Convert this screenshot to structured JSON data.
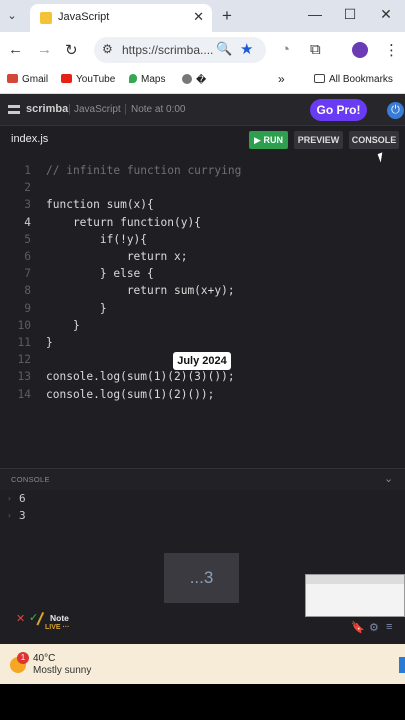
{
  "browser": {
    "tab_title": "JavaScript",
    "url": "https://scrimba....",
    "bookmarks": [
      "Gmail",
      "YouTube",
      "Maps",
      "�"
    ],
    "all_bookmarks": "All Bookmarks",
    "glyphs": {
      "menu": "⌄",
      "close": "✕",
      "new_tab": "+",
      "minimize": "—",
      "maximize": "☐",
      "back": "←",
      "forward": "→",
      "reload": "↻",
      "tune": "⚙",
      "zoom": "🔍",
      "star": "★",
      "ext1": "◔",
      "ext2": "⧉",
      "overflow": "»",
      "folder": "▭",
      "kebab": "⋮"
    }
  },
  "scrimba": {
    "logo": "scrimba",
    "crumb_course": "JavaScript",
    "crumb_note": "Note at 0:00",
    "go_pro": "Go Pro!",
    "power_glyph": "⏻",
    "filename": "index.js",
    "run": "▶ RUN",
    "preview": "PREVIEW",
    "console_btn": "CONSOLE"
  },
  "code_lines": [
    "// infinite function currying",
    "",
    "function sum(x){",
    "    return function(y){",
    "        if(!y){",
    "            return x;",
    "        } else {",
    "            return sum(x+y);",
    "        }",
    "    }",
    "}",
    "",
    "console.log(sum(1)(2)(3)());",
    "console.log(sum(1)(2)());"
  ],
  "date_badge": "July 2024",
  "console": {
    "label": "CONSOLE",
    "chevron": "⌄",
    "caret": "›",
    "outputs": [
      "6",
      "3"
    ]
  },
  "loading_text": "...3",
  "footer": {
    "x": "✕",
    "check": "✓",
    "note": "Note",
    "live": "LIVE ···",
    "icons": [
      "🔖",
      "⚙",
      "≡"
    ]
  },
  "taskbar": {
    "badge": "1",
    "temperature": "40°C",
    "condition": "Mostly sunny"
  }
}
